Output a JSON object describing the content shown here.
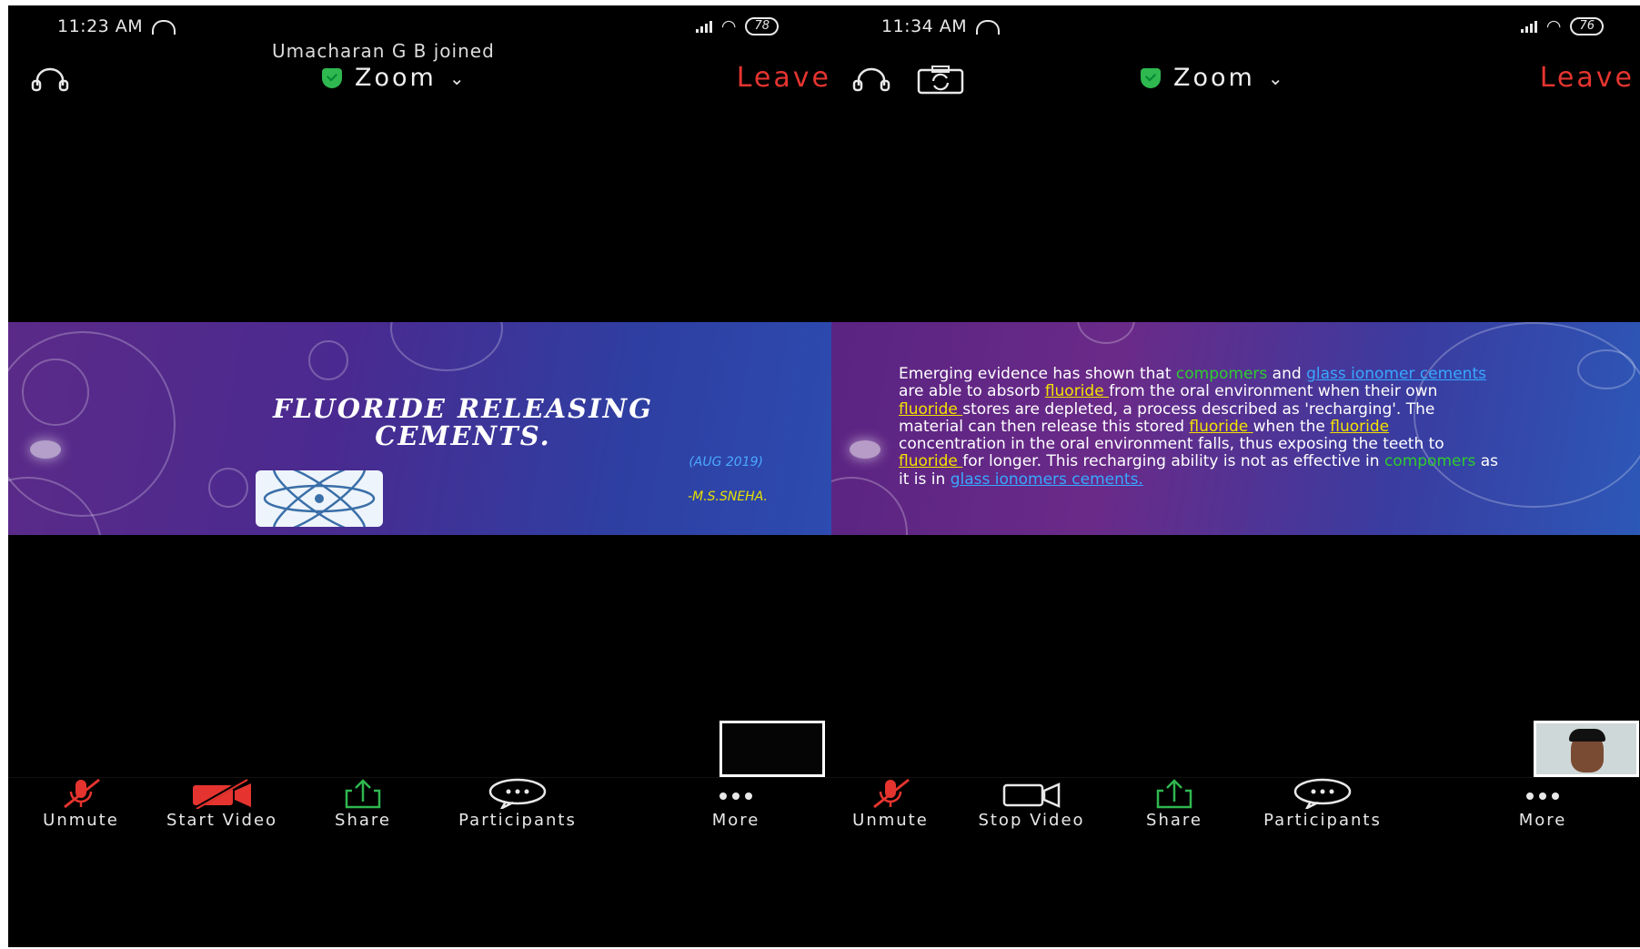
{
  "left": {
    "status": {
      "time": "11:23 AM",
      "battery": "78"
    },
    "notification": "Umacharan G B joined",
    "topbar": {
      "title": "Zoom",
      "leave": "Leave"
    },
    "slide": {
      "title_line1": "FLUORIDE RELEASING",
      "title_line2": "CEMENTS.",
      "date": "(AUG 2019)",
      "author": "-M.S.SNEHA."
    },
    "toolbar": {
      "unmute": "Unmute",
      "video": "Start Video",
      "share": "Share",
      "participants": "Participants",
      "more": "More"
    }
  },
  "right": {
    "status": {
      "time": "11:34 AM",
      "battery": "76"
    },
    "topbar": {
      "title": "Zoom",
      "leave": "Leave"
    },
    "slide": {
      "t1": "Emerging evidence has shown that ",
      "t2": "compomers",
      "t3": " and ",
      "t4": "glass ionomer cements",
      "t5": " are able to absorb ",
      "t6": "fluoride ",
      "t7": "from the oral environment when their own ",
      "t8": "fluoride ",
      "t9": "stores are depleted, a process described as 'recharging'. The material can then release this stored ",
      "t10": "fluoride ",
      "t11": "when the ",
      "t12": "fluoride ",
      "t13": "concentration in the oral environment falls, thus exposing the teeth to ",
      "t14": "fluoride ",
      "t15": "for longer. This recharging ability is not as effective in ",
      "t16": "compomers",
      "t17": " as it is in ",
      "t18": "glass ionomers cements."
    },
    "toolbar": {
      "unmute": "Unmute",
      "video": "Stop Video",
      "share": "Share",
      "participants": "Participants",
      "more": "More"
    }
  },
  "colors": {
    "leave": "#e5342f",
    "shield": "#2fb84f",
    "muted_red": "#e5342f",
    "share_green": "#2fb84f"
  }
}
